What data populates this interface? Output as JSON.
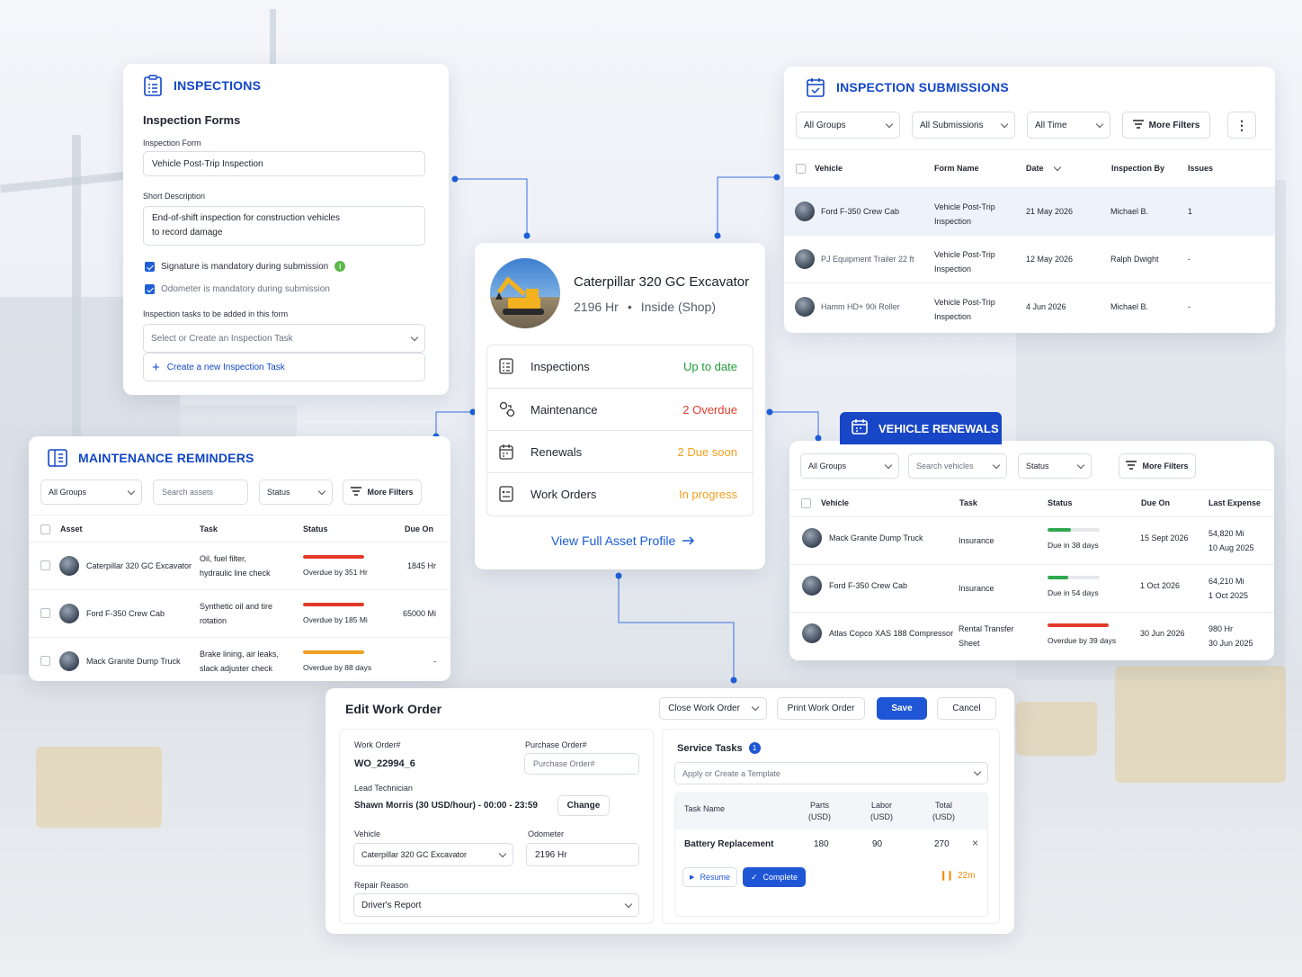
{
  "inspections": {
    "title": "INSPECTIONS",
    "subtitle": "Inspection Forms",
    "form_label": "Inspection Form",
    "form_value": "Vehicle Post-Trip Inspection",
    "desc_label": "Short Description",
    "desc_line1": "End-of-shift inspection for construction vehicles",
    "desc_line2": "to record damage",
    "signature_label": "Signature is mandatory during submission",
    "odometer_label": "Odometer is mandatory during submission",
    "tasks_label": "Inspection tasks to be added in this form",
    "tasks_placeholder": "Select or Create an Inspection Task",
    "create_task": "Create a new Inspection Task"
  },
  "submissions": {
    "title": "INSPECTION SUBMISSIONS",
    "filters": [
      "All Groups",
      "All Submissions",
      "All Time"
    ],
    "more_filters": "More Filters",
    "columns": [
      "Vehicle",
      "Form Name",
      "Date",
      "Inspection By",
      "Issues"
    ],
    "rows": [
      {
        "vehicle": "Ford F-350 Crew Cab",
        "form1": "Vehicle Post-Trip",
        "form2": "Inspection",
        "date": "21 May 2026",
        "by": "Michael B.",
        "issues": "1"
      },
      {
        "vehicle": "PJ Equipment Trailer 22 ft",
        "form1": "Vehicle Post-Trip",
        "form2": "Inspection",
        "date": "12 May 2026",
        "by": "Ralph Dwight",
        "issues": "-"
      },
      {
        "vehicle": "Hamm HD+ 90i Roller",
        "form1": "Vehicle Post-Trip",
        "form2": "Inspection",
        "date": "4 Jun 2026",
        "by": "Michael B.",
        "issues": "-"
      }
    ]
  },
  "asset": {
    "name": "Caterpillar 320 GC Excavator",
    "hours": "2196 Hr",
    "location": "Inside (Shop)",
    "items": [
      {
        "label": "Inspections",
        "status": "Up to date",
        "color": "#1f9d3a"
      },
      {
        "label": "Maintenance",
        "status": "2 Overdue",
        "color": "#e23a2a"
      },
      {
        "label": "Renewals",
        "status": "2 Due soon",
        "color": "#f0a020"
      },
      {
        "label": "Work Orders",
        "status": "In progress",
        "color": "#f0a020"
      }
    ],
    "link": "View Full Asset Profile"
  },
  "maintenance": {
    "title": "MAINTENANCE REMINDERS",
    "group_filter": "All Groups",
    "search_placeholder": "Search assets",
    "status_filter": "Status",
    "more_filters": "More Filters",
    "columns": [
      "Asset",
      "Task",
      "Status",
      "Due On"
    ],
    "rows": [
      {
        "asset": "Caterpillar 320 GC Excavator",
        "task1": "Oil, fuel filter,",
        "task2": "hydraulic line check",
        "status": "Overdue by 351 Hr",
        "due": "1845 Hr",
        "bar_color": "#e23a2a",
        "bar_pct": 1.0
      },
      {
        "asset": "Ford F-350 Crew Cab",
        "task1": "Synthetic oil and tire",
        "task2": "rotation",
        "status": "Overdue by 185 Mi",
        "due": "65000 Mi",
        "bar_color": "#e23a2a",
        "bar_pct": 1.0
      },
      {
        "asset": "Mack Granite Dump Truck",
        "task1": "Brake lining, air leaks,",
        "task2": "slack adjuster check",
        "status": "Overdue by 88 days",
        "due": "-",
        "bar_color": "#f0a020",
        "bar_pct": 1.0
      }
    ]
  },
  "renewals": {
    "title": "VEHICLE RENEWALS",
    "group_filter": "All Groups",
    "search_placeholder": "Search vehicles",
    "status_filter": "Status",
    "more_filters": "More Filters",
    "columns": [
      "Vehicle",
      "Task",
      "Status",
      "Due On",
      "Last Expense"
    ],
    "rows": [
      {
        "vehicle": "Mack Granite Dump Truck",
        "task1": "Insurance",
        "task2": "",
        "status": "Due in 38 days",
        "due": "15 Sept 2026",
        "exp1": "54,820 Mi",
        "exp2": "10 Aug 2025",
        "bar_color": "#2fa84f",
        "bar_pct": 0.45
      },
      {
        "vehicle": "Ford F-350 Crew Cab",
        "task1": "Insurance",
        "task2": "",
        "status": "Due in 54 days",
        "due": "1 Oct 2026",
        "exp1": "64,210 Mi",
        "exp2": "1 Oct 2025",
        "bar_color": "#2fa84f",
        "bar_pct": 0.4
      },
      {
        "vehicle": "Atlas Copco XAS 188 Compressor",
        "task1": "Rental Transfer",
        "task2": "Sheet",
        "status": "Overdue by 39 days",
        "due": "30 Jun 2026",
        "exp1": "980 Hr",
        "exp2": "30 Jun 2025",
        "bar_color": "#e23a2a",
        "bar_pct": 1.0
      }
    ]
  },
  "workorder": {
    "title": "Edit Work Order",
    "close_btn": "Close Work Order",
    "print_btn": "Print Work Order",
    "save_btn": "Save",
    "cancel_btn": "Cancel",
    "wo_label": "Work Order#",
    "wo_value": "WO_22994_6",
    "po_label": "Purchase Order#",
    "po_placeholder": "Purchase Order#",
    "tech_label": "Lead Technician",
    "tech_value": "Shawn Morris (30 USD/hour) - 00:00 - 23:59",
    "change_btn": "Change",
    "vehicle_label": "Vehicle",
    "vehicle_value": "Caterpillar 320 GC Excavator",
    "odometer_label": "Odometer",
    "odometer_value": "2196 Hr",
    "reason_label": "Repair Reason",
    "reason_value": "Driver's Report",
    "service_title": "Service Tasks",
    "service_count": "1",
    "template_placeholder": "Apply or Create a Template",
    "col_task": "Task Name",
    "col_parts1": "Parts",
    "col_parts2": "(USD)",
    "col_labor1": "Labor",
    "col_labor2": "(USD)",
    "col_total1": "Total",
    "col_total2": "(USD)",
    "task_name": "Battery Replacement",
    "parts": "180",
    "labor": "90",
    "total": "270",
    "resume_btn": "Resume",
    "complete_btn": "Complete",
    "timer": "22m"
  }
}
